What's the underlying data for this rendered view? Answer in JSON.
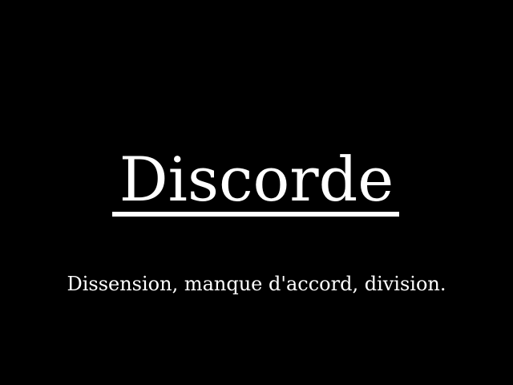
{
  "entry": {
    "word": "Discorde",
    "definition": "Dissension, manque d'accord, division."
  },
  "colors": {
    "background": "#000000",
    "text": "#ffffff"
  }
}
